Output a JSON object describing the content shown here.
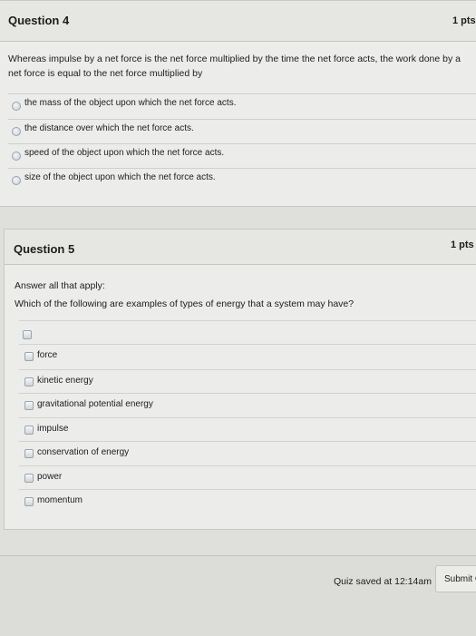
{
  "question4": {
    "title": "Question 4",
    "points": "1 pts",
    "text": "Whereas impulse by a net force is the net force multiplied by the time the net force acts, the work done by a net force is equal to the net force multiplied by",
    "options": [
      "the mass of the object upon which the net force acts.",
      "the distance over which the net force acts.",
      "speed of the object upon which the net force acts.",
      "size of the object upon which the net force acts."
    ]
  },
  "question5": {
    "title": "Question 5",
    "points": "1 pts",
    "instruction": "Answer all that apply:",
    "text": "Which of the following are examples of types of energy that a system may have?",
    "options": [
      "force",
      "kinetic energy",
      "gravitational potential energy",
      "impulse",
      "conservation of energy",
      "power",
      "momentum"
    ]
  },
  "footer": {
    "saved_text": "Quiz saved at 12:14am",
    "submit_label": "Submit C"
  }
}
